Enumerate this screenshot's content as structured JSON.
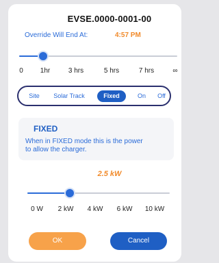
{
  "dialog": {
    "title": "EVSE.0000-0001-00",
    "override_label": "Override Will End At:",
    "override_time": "4:57 PM"
  },
  "duration_slider": {
    "ticks": [
      "0",
      "1hr",
      "3 hrs",
      "5 hrs",
      "7 hrs",
      "∞"
    ],
    "value_fraction": 0.15
  },
  "modes": {
    "items": [
      "Site",
      "Solar Track",
      "Fixed",
      "On",
      "Off"
    ],
    "selected": "Fixed"
  },
  "info": {
    "heading": "FIXED",
    "text_line1": "When in FIXED mode this is the power",
    "text_line2": "to allow the charger."
  },
  "power": {
    "value_label": "2.5 kW",
    "ticks": [
      "0 W",
      "2 kW",
      "4 kW",
      "6 kW",
      "10 kW"
    ],
    "value_fraction": 0.3
  },
  "buttons": {
    "ok_label": "OK",
    "cancel_label": "Cancel"
  },
  "colors": {
    "accent_blue": "#2a6bd8",
    "accent_orange": "#f18a2a"
  }
}
